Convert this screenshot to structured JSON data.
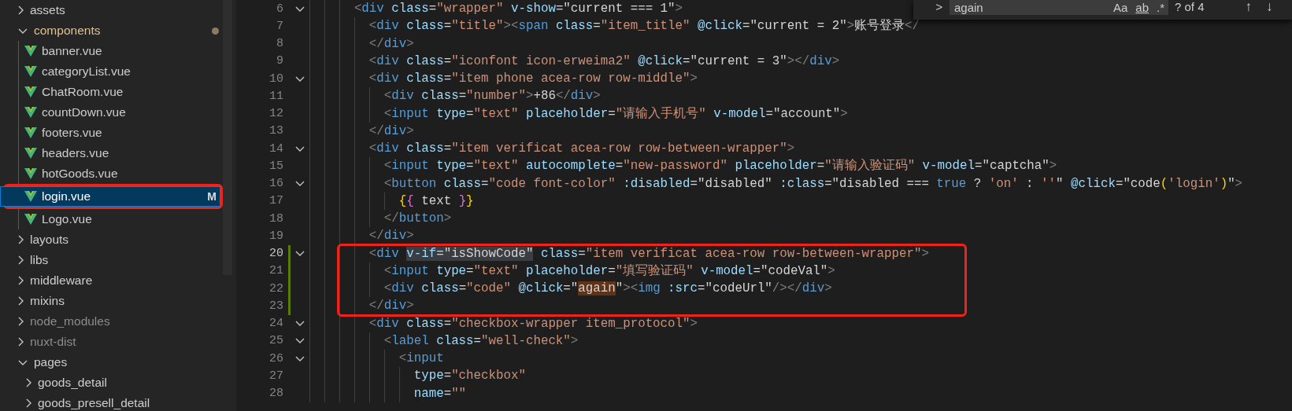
{
  "explorer": {
    "items": [
      {
        "kind": "folder",
        "label": "assets",
        "expanded": false,
        "selected": false,
        "modified": false,
        "dimmed": false,
        "annotated": false
      },
      {
        "kind": "folder",
        "label": "components",
        "expanded": true,
        "selected": false,
        "modified": true,
        "dimmed": false,
        "annotated": false,
        "children": [
          {
            "kind": "vue",
            "label": "banner.vue",
            "selected": false,
            "modified": false,
            "dimmed": false,
            "annotated": false
          },
          {
            "kind": "vue",
            "label": "categoryList.vue",
            "selected": false,
            "modified": false,
            "dimmed": false,
            "annotated": false
          },
          {
            "kind": "vue",
            "label": "ChatRoom.vue",
            "selected": false,
            "modified": false,
            "dimmed": false,
            "annotated": false
          },
          {
            "kind": "vue",
            "label": "countDown.vue",
            "selected": false,
            "modified": false,
            "dimmed": false,
            "annotated": false
          },
          {
            "kind": "vue",
            "label": "footers.vue",
            "selected": false,
            "modified": false,
            "dimmed": false,
            "annotated": false
          },
          {
            "kind": "vue",
            "label": "headers.vue",
            "selected": false,
            "modified": false,
            "dimmed": false,
            "annotated": false
          },
          {
            "kind": "vue",
            "label": "hotGoods.vue",
            "selected": false,
            "modified": false,
            "dimmed": false,
            "annotated": false
          },
          {
            "kind": "vue",
            "label": "login.vue",
            "selected": true,
            "modified": true,
            "dimmed": false,
            "annotated": true,
            "badge": "M"
          },
          {
            "kind": "vue",
            "label": "Logo.vue",
            "selected": false,
            "modified": false,
            "dimmed": false,
            "annotated": false
          }
        ]
      },
      {
        "kind": "folder",
        "label": "layouts",
        "expanded": false,
        "selected": false,
        "modified": false,
        "dimmed": false,
        "annotated": false
      },
      {
        "kind": "folder",
        "label": "libs",
        "expanded": false,
        "selected": false,
        "modified": false,
        "dimmed": false,
        "annotated": false
      },
      {
        "kind": "folder",
        "label": "middleware",
        "expanded": false,
        "selected": false,
        "modified": false,
        "dimmed": false,
        "annotated": false
      },
      {
        "kind": "folder",
        "label": "mixins",
        "expanded": false,
        "selected": false,
        "modified": false,
        "dimmed": false,
        "annotated": false
      },
      {
        "kind": "folder",
        "label": "node_modules",
        "expanded": false,
        "selected": false,
        "modified": false,
        "dimmed": true,
        "annotated": false
      },
      {
        "kind": "folder",
        "label": "nuxt-dist",
        "expanded": false,
        "selected": false,
        "modified": false,
        "dimmed": true,
        "annotated": false
      },
      {
        "kind": "folder",
        "label": "pages",
        "expanded": true,
        "selected": false,
        "modified": false,
        "dimmed": false,
        "annotated": false,
        "children": [
          {
            "kind": "folder",
            "label": "goods_detail",
            "expanded": false,
            "selected": false,
            "modified": false,
            "dimmed": false,
            "annotated": false
          },
          {
            "kind": "folder",
            "label": "goods_presell_detail",
            "expanded": false,
            "selected": false,
            "modified": false,
            "dimmed": false,
            "annotated": false
          }
        ]
      }
    ]
  },
  "editor": {
    "lines": [
      {
        "number": "6",
        "selected": false,
        "foldable": true,
        "modified": false,
        "annotated": false,
        "tokens": [
          {
            "kind": "punct",
            "text": "      <"
          },
          {
            "kind": "tag",
            "text": "div"
          },
          {
            "kind": "attr",
            "text": " class"
          },
          {
            "kind": "plain",
            "text": "="
          },
          {
            "kind": "string",
            "text": "\"wrapper\""
          },
          {
            "kind": "attr",
            "text": " v-show"
          },
          {
            "kind": "plain",
            "text": "=\"current === 1\""
          },
          {
            "kind": "punct",
            "text": ">"
          }
        ]
      },
      {
        "number": "7",
        "selected": false,
        "foldable": false,
        "modified": false,
        "annotated": false,
        "tokens": [
          {
            "kind": "punct",
            "text": "        <"
          },
          {
            "kind": "tag",
            "text": "div"
          },
          {
            "kind": "attr",
            "text": " class"
          },
          {
            "kind": "plain",
            "text": "="
          },
          {
            "kind": "string",
            "text": "\"title\""
          },
          {
            "kind": "punct",
            "text": "><"
          },
          {
            "kind": "tag",
            "text": "span"
          },
          {
            "kind": "attr",
            "text": " class"
          },
          {
            "kind": "plain",
            "text": "="
          },
          {
            "kind": "string",
            "text": "\"item_title\""
          },
          {
            "kind": "attr",
            "text": " @click"
          },
          {
            "kind": "plain",
            "text": "=\"current = 2\""
          },
          {
            "kind": "punct",
            "text": ">"
          },
          {
            "kind": "plain",
            "text": "账号登录"
          },
          {
            "kind": "punct",
            "text": "</"
          }
        ]
      },
      {
        "number": "8",
        "selected": false,
        "foldable": false,
        "modified": false,
        "annotated": false,
        "tokens": [
          {
            "kind": "punct",
            "text": "        </"
          },
          {
            "kind": "tag",
            "text": "div"
          },
          {
            "kind": "punct",
            "text": ">"
          }
        ]
      },
      {
        "number": "9",
        "selected": false,
        "foldable": false,
        "modified": false,
        "annotated": false,
        "tokens": [
          {
            "kind": "punct",
            "text": "        <"
          },
          {
            "kind": "tag",
            "text": "div"
          },
          {
            "kind": "attr",
            "text": " class"
          },
          {
            "kind": "plain",
            "text": "="
          },
          {
            "kind": "string",
            "text": "\"iconfont icon-erweima2\""
          },
          {
            "kind": "attr",
            "text": " @click"
          },
          {
            "kind": "plain",
            "text": "=\"current = 3\""
          },
          {
            "kind": "punct",
            "text": "></"
          },
          {
            "kind": "tag",
            "text": "div"
          },
          {
            "kind": "punct",
            "text": ">"
          }
        ]
      },
      {
        "number": "10",
        "selected": false,
        "foldable": true,
        "modified": false,
        "annotated": false,
        "tokens": [
          {
            "kind": "punct",
            "text": "        <"
          },
          {
            "kind": "tag",
            "text": "div"
          },
          {
            "kind": "attr",
            "text": " class"
          },
          {
            "kind": "plain",
            "text": "="
          },
          {
            "kind": "string",
            "text": "\"item phone acea-row row-middle\""
          },
          {
            "kind": "punct",
            "text": ">"
          }
        ]
      },
      {
        "number": "11",
        "selected": false,
        "foldable": false,
        "modified": false,
        "annotated": false,
        "tokens": [
          {
            "kind": "punct",
            "text": "          <"
          },
          {
            "kind": "tag",
            "text": "div"
          },
          {
            "kind": "attr",
            "text": " class"
          },
          {
            "kind": "plain",
            "text": "="
          },
          {
            "kind": "string",
            "text": "\"number\""
          },
          {
            "kind": "punct",
            "text": ">"
          },
          {
            "kind": "plain",
            "text": "+86"
          },
          {
            "kind": "punct",
            "text": "</"
          },
          {
            "kind": "tag",
            "text": "div"
          },
          {
            "kind": "punct",
            "text": ">"
          }
        ]
      },
      {
        "number": "12",
        "selected": false,
        "foldable": false,
        "modified": false,
        "annotated": false,
        "tokens": [
          {
            "kind": "punct",
            "text": "          <"
          },
          {
            "kind": "tag",
            "text": "input"
          },
          {
            "kind": "attr",
            "text": " type"
          },
          {
            "kind": "plain",
            "text": "="
          },
          {
            "kind": "string",
            "text": "\"text\""
          },
          {
            "kind": "attr",
            "text": " placeholder"
          },
          {
            "kind": "plain",
            "text": "="
          },
          {
            "kind": "string",
            "text": "\"请输入手机号\""
          },
          {
            "kind": "attr",
            "text": " v-model"
          },
          {
            "kind": "plain",
            "text": "=\"account\""
          },
          {
            "kind": "punct",
            "text": ">"
          }
        ]
      },
      {
        "number": "13",
        "selected": false,
        "foldable": false,
        "modified": false,
        "annotated": false,
        "tokens": [
          {
            "kind": "punct",
            "text": "        </"
          },
          {
            "kind": "tag",
            "text": "div"
          },
          {
            "kind": "punct",
            "text": ">"
          }
        ]
      },
      {
        "number": "14",
        "selected": false,
        "foldable": true,
        "modified": false,
        "annotated": false,
        "tokens": [
          {
            "kind": "punct",
            "text": "        <"
          },
          {
            "kind": "tag",
            "text": "div"
          },
          {
            "kind": "attr",
            "text": " class"
          },
          {
            "kind": "plain",
            "text": "="
          },
          {
            "kind": "string",
            "text": "\"item verificat acea-row row-between-wrapper\""
          },
          {
            "kind": "punct",
            "text": ">"
          }
        ]
      },
      {
        "number": "15",
        "selected": false,
        "foldable": false,
        "modified": false,
        "annotated": false,
        "tokens": [
          {
            "kind": "punct",
            "text": "          <"
          },
          {
            "kind": "tag",
            "text": "input"
          },
          {
            "kind": "attr",
            "text": " type"
          },
          {
            "kind": "plain",
            "text": "="
          },
          {
            "kind": "string",
            "text": "\"text\""
          },
          {
            "kind": "attr",
            "text": " autocomplete"
          },
          {
            "kind": "plain",
            "text": "="
          },
          {
            "kind": "string",
            "text": "\"new-password\""
          },
          {
            "kind": "attr",
            "text": " placeholder"
          },
          {
            "kind": "plain",
            "text": "="
          },
          {
            "kind": "string",
            "text": "\"请输入验证码\""
          },
          {
            "kind": "attr",
            "text": " v-model"
          },
          {
            "kind": "plain",
            "text": "=\"captcha\""
          },
          {
            "kind": "punct",
            "text": ">"
          }
        ]
      },
      {
        "number": "16",
        "selected": false,
        "foldable": true,
        "modified": false,
        "annotated": false,
        "tokens": [
          {
            "kind": "punct",
            "text": "          <"
          },
          {
            "kind": "tag",
            "text": "button"
          },
          {
            "kind": "attr",
            "text": " class"
          },
          {
            "kind": "plain",
            "text": "="
          },
          {
            "kind": "string",
            "text": "\"code font-color\""
          },
          {
            "kind": "attr",
            "text": " :disabled"
          },
          {
            "kind": "plain",
            "text": "=\"disabled\""
          },
          {
            "kind": "attr",
            "text": " :class"
          },
          {
            "kind": "plain",
            "text": "=\"disabled === "
          },
          {
            "kind": "keyword",
            "text": "true"
          },
          {
            "kind": "plain",
            "text": " ? "
          },
          {
            "kind": "string",
            "text": "'on'"
          },
          {
            "kind": "plain",
            "text": " : "
          },
          {
            "kind": "string",
            "text": "''"
          },
          {
            "kind": "plain",
            "text": "\""
          },
          {
            "kind": "attr",
            "text": " @click"
          },
          {
            "kind": "plain",
            "text": "=\"code"
          },
          {
            "kind": "bracket1",
            "text": "("
          },
          {
            "kind": "string",
            "text": "'login'"
          },
          {
            "kind": "bracket1",
            "text": ")"
          },
          {
            "kind": "plain",
            "text": "\""
          },
          {
            "kind": "punct",
            "text": ">"
          }
        ]
      },
      {
        "number": "17",
        "selected": false,
        "foldable": false,
        "modified": false,
        "annotated": false,
        "tokens": [
          {
            "kind": "bracket1",
            "text": "            {"
          },
          {
            "kind": "bracket2",
            "text": "{"
          },
          {
            "kind": "plain",
            "text": " text "
          },
          {
            "kind": "bracket2",
            "text": "}"
          },
          {
            "kind": "bracket1",
            "text": "}"
          }
        ]
      },
      {
        "number": "18",
        "selected": false,
        "foldable": false,
        "modified": false,
        "annotated": false,
        "tokens": [
          {
            "kind": "punct",
            "text": "          </"
          },
          {
            "kind": "tag",
            "text": "button"
          },
          {
            "kind": "punct",
            "text": ">"
          }
        ]
      },
      {
        "number": "19",
        "selected": false,
        "foldable": false,
        "modified": false,
        "annotated": false,
        "tokens": [
          {
            "kind": "punct",
            "text": "        </"
          },
          {
            "kind": "tag",
            "text": "div"
          },
          {
            "kind": "punct",
            "text": ">"
          }
        ]
      },
      {
        "number": "20",
        "selected": true,
        "foldable": true,
        "modified": true,
        "annotated": true,
        "tokens": [
          {
            "kind": "punct",
            "text": "        <"
          },
          {
            "kind": "tag",
            "text": "div "
          },
          {
            "kind": "attr",
            "text": "v-if",
            "selected": true
          },
          {
            "kind": "plain",
            "text": "=\"isShowCode\"",
            "selected": true
          },
          {
            "kind": "attr",
            "text": " class"
          },
          {
            "kind": "plain",
            "text": "="
          },
          {
            "kind": "string",
            "text": "\"item verificat acea-row row-between-wrapper\""
          },
          {
            "kind": "punct",
            "text": ">"
          }
        ]
      },
      {
        "number": "21",
        "selected": false,
        "foldable": false,
        "modified": true,
        "annotated": true,
        "tokens": [
          {
            "kind": "punct",
            "text": "          <"
          },
          {
            "kind": "tag",
            "text": "input"
          },
          {
            "kind": "attr",
            "text": " type"
          },
          {
            "kind": "plain",
            "text": "="
          },
          {
            "kind": "string",
            "text": "\"text\""
          },
          {
            "kind": "attr",
            "text": " placeholder"
          },
          {
            "kind": "plain",
            "text": "="
          },
          {
            "kind": "string",
            "text": "\"填写验证码\""
          },
          {
            "kind": "attr",
            "text": " v-model"
          },
          {
            "kind": "plain",
            "text": "=\"codeVal\""
          },
          {
            "kind": "punct",
            "text": ">"
          }
        ]
      },
      {
        "number": "22",
        "selected": false,
        "foldable": false,
        "modified": true,
        "annotated": true,
        "tokens": [
          {
            "kind": "punct",
            "text": "          <"
          },
          {
            "kind": "tag",
            "text": "div"
          },
          {
            "kind": "attr",
            "text": " class"
          },
          {
            "kind": "plain",
            "text": "="
          },
          {
            "kind": "string",
            "text": "\"code\""
          },
          {
            "kind": "attr",
            "text": " @click"
          },
          {
            "kind": "plain",
            "text": "=\""
          },
          {
            "kind": "plain",
            "text": "again",
            "matched": true
          },
          {
            "kind": "plain",
            "text": "\""
          },
          {
            "kind": "punct",
            "text": "><"
          },
          {
            "kind": "tag",
            "text": "img"
          },
          {
            "kind": "attr",
            "text": " :src"
          },
          {
            "kind": "plain",
            "text": "=\"codeUrl\""
          },
          {
            "kind": "punct",
            "text": "/></"
          },
          {
            "kind": "tag",
            "text": "div"
          },
          {
            "kind": "punct",
            "text": ">"
          }
        ]
      },
      {
        "number": "23",
        "selected": false,
        "foldable": false,
        "modified": true,
        "annotated": true,
        "tokens": [
          {
            "kind": "punct",
            "text": "        </"
          },
          {
            "kind": "tag",
            "text": "div"
          },
          {
            "kind": "punct",
            "text": ">"
          }
        ]
      },
      {
        "number": "24",
        "selected": false,
        "foldable": true,
        "modified": false,
        "annotated": false,
        "tokens": [
          {
            "kind": "punct",
            "text": "        <"
          },
          {
            "kind": "tag",
            "text": "div"
          },
          {
            "kind": "attr",
            "text": " class"
          },
          {
            "kind": "plain",
            "text": "="
          },
          {
            "kind": "string",
            "text": "\"checkbox-wrapper item_protocol\""
          },
          {
            "kind": "punct",
            "text": ">"
          }
        ]
      },
      {
        "number": "25",
        "selected": false,
        "foldable": true,
        "modified": false,
        "annotated": false,
        "tokens": [
          {
            "kind": "punct",
            "text": "          <"
          },
          {
            "kind": "tag",
            "text": "label"
          },
          {
            "kind": "attr",
            "text": " class"
          },
          {
            "kind": "plain",
            "text": "="
          },
          {
            "kind": "string",
            "text": "\"well-check\""
          },
          {
            "kind": "punct",
            "text": ">"
          }
        ]
      },
      {
        "number": "26",
        "selected": false,
        "foldable": true,
        "modified": false,
        "annotated": false,
        "tokens": [
          {
            "kind": "punct",
            "text": "            <"
          },
          {
            "kind": "tag",
            "text": "input"
          }
        ]
      },
      {
        "number": "27",
        "selected": false,
        "foldable": false,
        "modified": false,
        "annotated": false,
        "tokens": [
          {
            "kind": "attr",
            "text": "              type"
          },
          {
            "kind": "plain",
            "text": "="
          },
          {
            "kind": "string",
            "text": "\"checkbox\""
          }
        ]
      },
      {
        "number": "28",
        "selected": false,
        "foldable": false,
        "modified": false,
        "annotated": false,
        "tokens": [
          {
            "kind": "attr",
            "text": "              name"
          },
          {
            "kind": "plain",
            "text": "="
          },
          {
            "kind": "string",
            "text": "\"\""
          }
        ]
      }
    ]
  },
  "find_widget": {
    "toggle": ">",
    "value": "again",
    "options": [
      {
        "kind": "case",
        "text": "Aa",
        "selected": false
      },
      {
        "kind": "word",
        "text": "ab",
        "selected": false
      },
      {
        "kind": "regex",
        "text": ".*",
        "selected": false
      }
    ],
    "count": "? of 4",
    "previous": "↑",
    "next": "↓"
  }
}
